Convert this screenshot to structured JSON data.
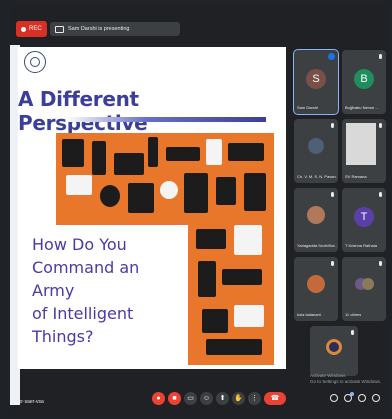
{
  "topbar": {
    "rec_label": "REC",
    "presenting_text": "Sam Darshi is presenting"
  },
  "slide": {
    "title": "A Different Perspective",
    "question_lines": [
      "How Do You",
      "Command an Army",
      "of Intelligent Things?"
    ]
  },
  "participants": [
    {
      "name": "Sam Darshi",
      "initial": "S",
      "color": "#7a4f4a",
      "kind": "avatar"
    },
    {
      "name": "Bujjibabu Nenne…",
      "initial": "B",
      "color": "#1e8e5e",
      "kind": "avatar"
    },
    {
      "name": "Ch. V. M. S. N. Pavan…",
      "initial": "",
      "color": "#4e5f76",
      "kind": "photo"
    },
    {
      "name": "SV Ramana",
      "initial": "",
      "color": "#8c8c8c",
      "kind": "photo"
    },
    {
      "name": "Yarlagadda SruthiSai…",
      "initial": "",
      "color": "#b07a5a",
      "kind": "photo"
    },
    {
      "name": "T Krishna Rathala",
      "initial": "T",
      "color": "#5b3fa8",
      "kind": "avatar"
    },
    {
      "name": "kola balanant",
      "initial": "",
      "color": "#c46a3a",
      "kind": "photo"
    },
    {
      "name": "11 others",
      "initial": "",
      "color": "#6a5a8a",
      "kind": "photo"
    },
    {
      "name": "",
      "initial": "",
      "color": "#2e2a5a",
      "kind": "photo"
    }
  ],
  "watermark": {
    "line1": "Activate Windows",
    "line2": "Go to Settings to activate Windows."
  },
  "bottombar": {
    "meeting_code": "nkr-saer-vsa"
  },
  "colors": {
    "accent": "#1a73e8",
    "danger": "#ea4335",
    "slide_orange": "#e8762b",
    "slide_title": "#3b3f99"
  }
}
